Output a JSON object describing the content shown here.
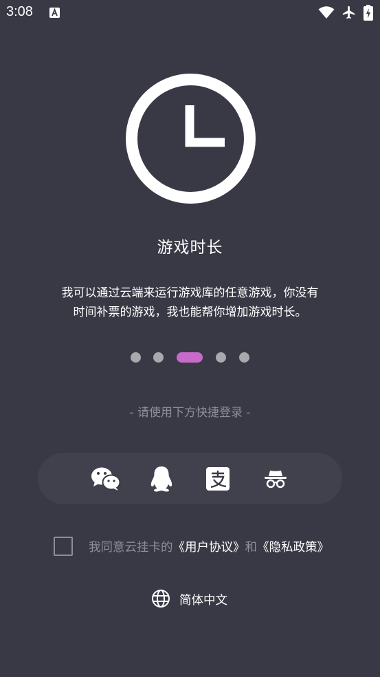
{
  "status_bar": {
    "time": "3:08"
  },
  "feature": {
    "title": "游戏时长",
    "description_line1": "我可以通过云端来运行游戏库的任意游戏，你没有",
    "description_line2": "时间补票的游戏，我也能帮你增加游戏时长。"
  },
  "pager": {
    "count": 5,
    "active_index": 2,
    "active_color": "#c66bc9",
    "inactive_color": "#a8a8ad"
  },
  "login": {
    "hint": "- 请使用下方快捷登录 -",
    "options": [
      {
        "name": "wechat",
        "icon": "wechat-icon"
      },
      {
        "name": "qq",
        "icon": "qq-icon"
      },
      {
        "name": "alipay",
        "icon": "alipay-icon"
      },
      {
        "name": "guest",
        "icon": "incognito-icon"
      }
    ]
  },
  "agreement": {
    "prefix": "我同意云挂卡的",
    "user_agreement": "《用户协议》",
    "conjunction": "和",
    "privacy_policy": "《隐私政策》",
    "checked": false
  },
  "language": {
    "label": "简体中文",
    "icon": "globe-icon"
  },
  "colors": {
    "background": "#393946",
    "accent": "#c66bc9",
    "muted_text": "#8e8e99"
  }
}
